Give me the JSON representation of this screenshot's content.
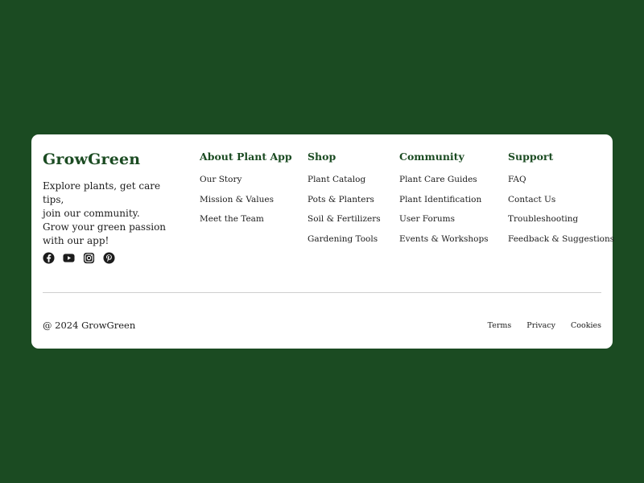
{
  "brand": {
    "name": "GrowGreen",
    "tagline_lines": [
      "Explore plants, get care tips,",
      "join our community.",
      "Grow your green passion",
      "with our app!"
    ],
    "color": "#1b4b22"
  },
  "social": [
    {
      "icon": "facebook-icon"
    },
    {
      "icon": "youtube-icon"
    },
    {
      "icon": "instagram-icon"
    },
    {
      "icon": "pinterest-icon"
    }
  ],
  "columns": [
    {
      "title": "About Plant App",
      "links": [
        "Our Story",
        "Mission & Values",
        "Meet the Team"
      ]
    },
    {
      "title": "Shop",
      "links": [
        "Plant Catalog",
        "Pots & Planters",
        "Soil & Fertilizers",
        "Gardening Tools"
      ]
    },
    {
      "title": "Community",
      "links": [
        "Plant Care Guides",
        "Plant Identification",
        "User Forums",
        "Events & Workshops"
      ]
    },
    {
      "title": "Support",
      "links": [
        "FAQ",
        "Contact Us",
        "Troubleshooting",
        "Feedback & Suggestions"
      ]
    }
  ],
  "bottom": {
    "copyright": "@ 2024 GrowGreen",
    "legal_links": [
      "Terms",
      "Privacy",
      "Cookies"
    ]
  },
  "colors": {
    "background": "#1b4b22",
    "card": "#ffffff",
    "heading": "#1b4b22"
  }
}
